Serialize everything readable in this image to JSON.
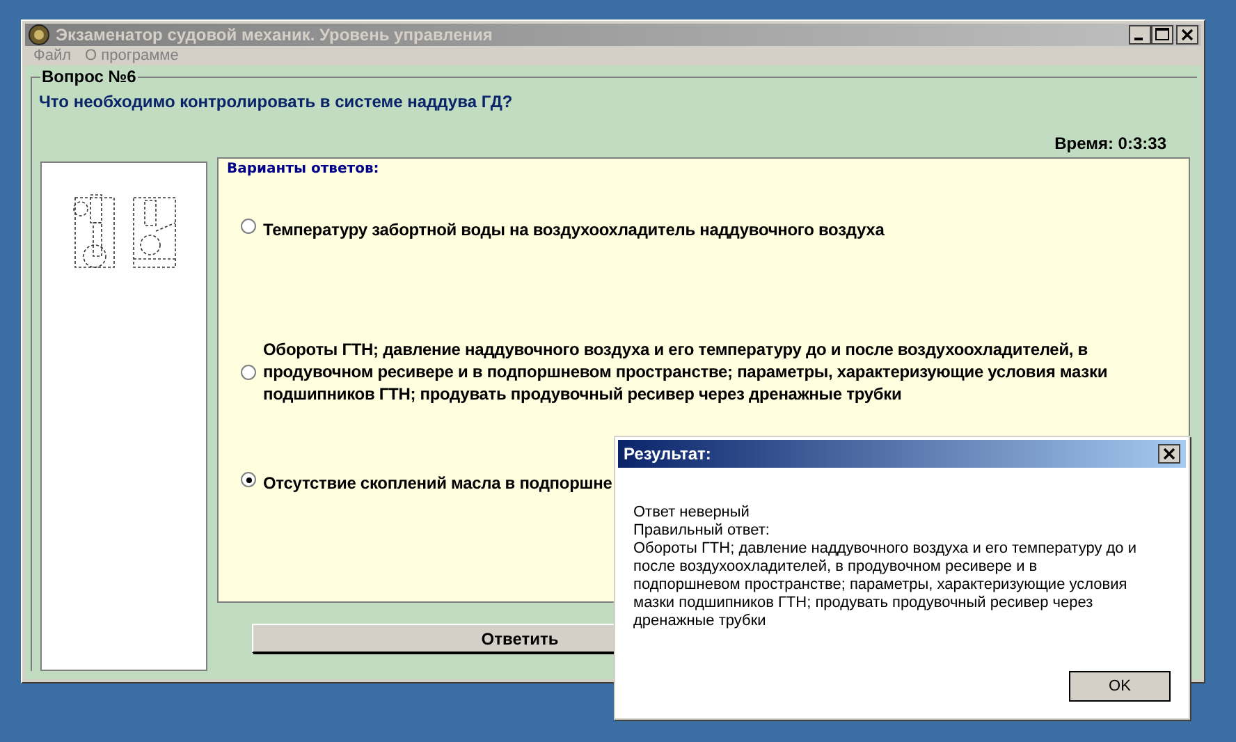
{
  "window": {
    "title": "Экзаменатор судовой механик. Уровень управления"
  },
  "menu": [
    "Файл",
    "О программе"
  ],
  "question": {
    "heading": "Вопрос №6",
    "text": "Что необходимо контролировать в системе наддува ГД?",
    "timer": "Время: 0:3:33"
  },
  "answers": {
    "title": "Варианты ответов:",
    "options": [
      {
        "text": "Температуру забортной воды на воздухоохладитель наддувочного воздуха",
        "selected": false
      },
      {
        "text": "Обороты ГТН; давление наддувочного воздуха и его температуру до и после воздухоохладителей, в продувочном ресивере и в подпоршневом пространстве; параметры, характеризующие условия мазки подшипников ГТН; продувать продувочный ресивер через дренажные трубки",
        "selected": false
      },
      {
        "text": "Отсутствие скоплений масла в подпоршне",
        "selected": true
      }
    ]
  },
  "submit_button": "Ответить",
  "dialog": {
    "title": "Результат:",
    "lines": [
      "Ответ неверный",
      "Правильный ответ:",
      "Обороты ГТН; давление наддувочного воздуха и его температуру до и после воздухоохладителей, в продувочном ресивере и в подпоршневом пространстве; параметры, характеризующие условия мазки подшипников ГТН; продувать продувочный ресивер через дренажные трубки"
    ],
    "ok_button": "OK"
  }
}
